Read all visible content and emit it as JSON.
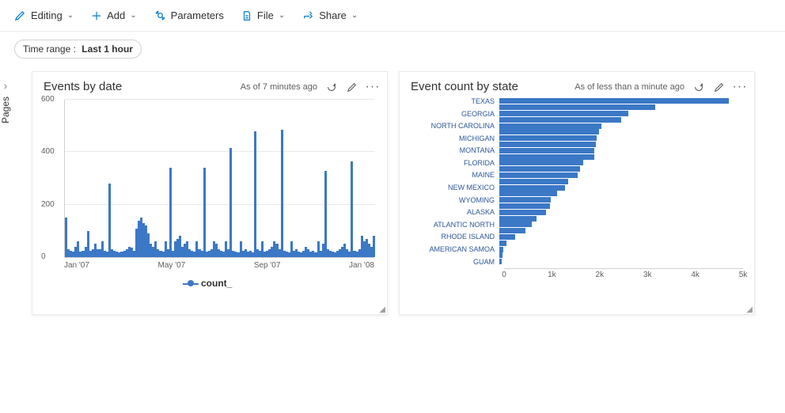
{
  "toolbar": {
    "editing": "Editing",
    "add": "Add",
    "parameters": "Parameters",
    "file": "File",
    "share": "Share"
  },
  "time_range": {
    "label": "Time range",
    "value": "Last 1 hour"
  },
  "pages_label": "Pages",
  "card1": {
    "title": "Events by date",
    "as_of": "As of 7 minutes ago"
  },
  "card2": {
    "title": "Event count by state",
    "as_of": "As of less than a minute ago"
  },
  "legend": {
    "series_name": "count_"
  },
  "chart_data": [
    {
      "type": "bar",
      "title": "Events by date",
      "xlabel": "",
      "ylabel": "",
      "ylim": [
        0,
        600
      ],
      "xticks": [
        "Jan '07",
        "May '07",
        "Sep '07",
        "Jan '08"
      ],
      "yticks": [
        0,
        200,
        400,
        600
      ],
      "series": [
        {
          "name": "count_",
          "values": [
            150,
            30,
            25,
            20,
            40,
            60,
            20,
            25,
            40,
            100,
            25,
            30,
            50,
            30,
            30,
            60,
            25,
            20,
            280,
            30,
            25,
            20,
            18,
            20,
            25,
            30,
            40,
            35,
            25,
            110,
            140,
            150,
            130,
            120,
            90,
            50,
            40,
            60,
            30,
            25,
            20,
            60,
            30,
            340,
            25,
            60,
            70,
            80,
            40,
            50,
            60,
            30,
            25,
            20,
            60,
            30,
            25,
            340,
            20,
            25,
            30,
            60,
            50,
            30,
            25,
            20,
            60,
            30,
            415,
            25,
            20,
            18,
            60,
            25,
            30,
            20,
            25,
            18,
            480,
            30,
            25,
            60,
            20,
            25,
            30,
            40,
            60,
            50,
            30,
            485,
            25,
            20,
            18,
            60,
            25,
            30,
            20,
            18,
            25,
            40,
            30,
            20,
            25,
            18,
            60,
            25,
            50,
            330,
            30,
            25,
            20,
            18,
            25,
            30,
            40,
            50,
            30,
            20,
            365,
            25,
            20,
            30,
            80,
            60,
            70,
            50,
            40,
            80
          ]
        }
      ]
    },
    {
      "type": "bar",
      "orientation": "horizontal",
      "title": "Event count by state",
      "xlim": [
        0,
        5000
      ],
      "xticks": [
        0,
        1000,
        2000,
        3000,
        4000,
        5000
      ],
      "xtick_labels": [
        "0",
        "1k",
        "2k",
        "3k",
        "4k",
        "5k"
      ],
      "categories": [
        "TEXAS",
        "",
        "GEORGIA",
        "",
        "NORTH CAROLINA",
        "",
        "MICHIGAN",
        "",
        "MONTANA",
        "",
        "FLORIDA",
        "",
        "MAINE",
        "",
        "NEW MEXICO",
        "",
        "WYOMING",
        "",
        "ALASKA",
        "",
        "ATLANTIC NORTH",
        "",
        "RHODE ISLAND",
        "",
        "AMERICAN SAMOA",
        "",
        "GUAM"
      ],
      "values": [
        4700,
        3200,
        2650,
        2500,
        2100,
        2050,
        2000,
        1980,
        1950,
        1940,
        1720,
        1650,
        1600,
        1420,
        1340,
        1190,
        1060,
        1040,
        950,
        770,
        670,
        540,
        320,
        150,
        80,
        60,
        50
      ]
    }
  ]
}
